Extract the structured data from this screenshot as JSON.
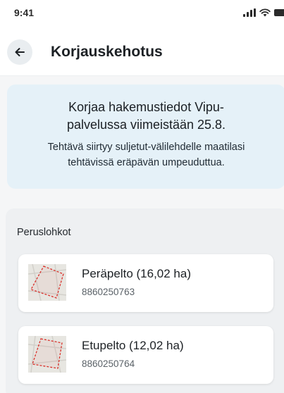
{
  "status_bar": {
    "time": "9:41"
  },
  "header": {
    "title": "Korjauskehotus"
  },
  "notice": {
    "title": "Korjaa hakemustiedot Vipu-palvelussa viimeistään 25.8.",
    "text": "Tehtävä siirtyy suljetut-välilehdelle maatilasi tehtävissä eräpävän umpeuduttua."
  },
  "parcels_section": {
    "title": "Peruslohkot",
    "items": [
      {
        "name": "Peräpelto (16,02 ha)",
        "id": "8860250763"
      },
      {
        "name": "Etupelto (12,02 ha)",
        "id": "8860250764"
      }
    ]
  },
  "colors": {
    "notice_bg": "#e5f1f8",
    "section_bg": "#eef0f2",
    "parcel_outline": "#d9312b"
  },
  "icons": [
    "back-arrow-icon",
    "signal-icon",
    "wifi-icon",
    "battery-icon",
    "parcel-map-icon"
  ]
}
